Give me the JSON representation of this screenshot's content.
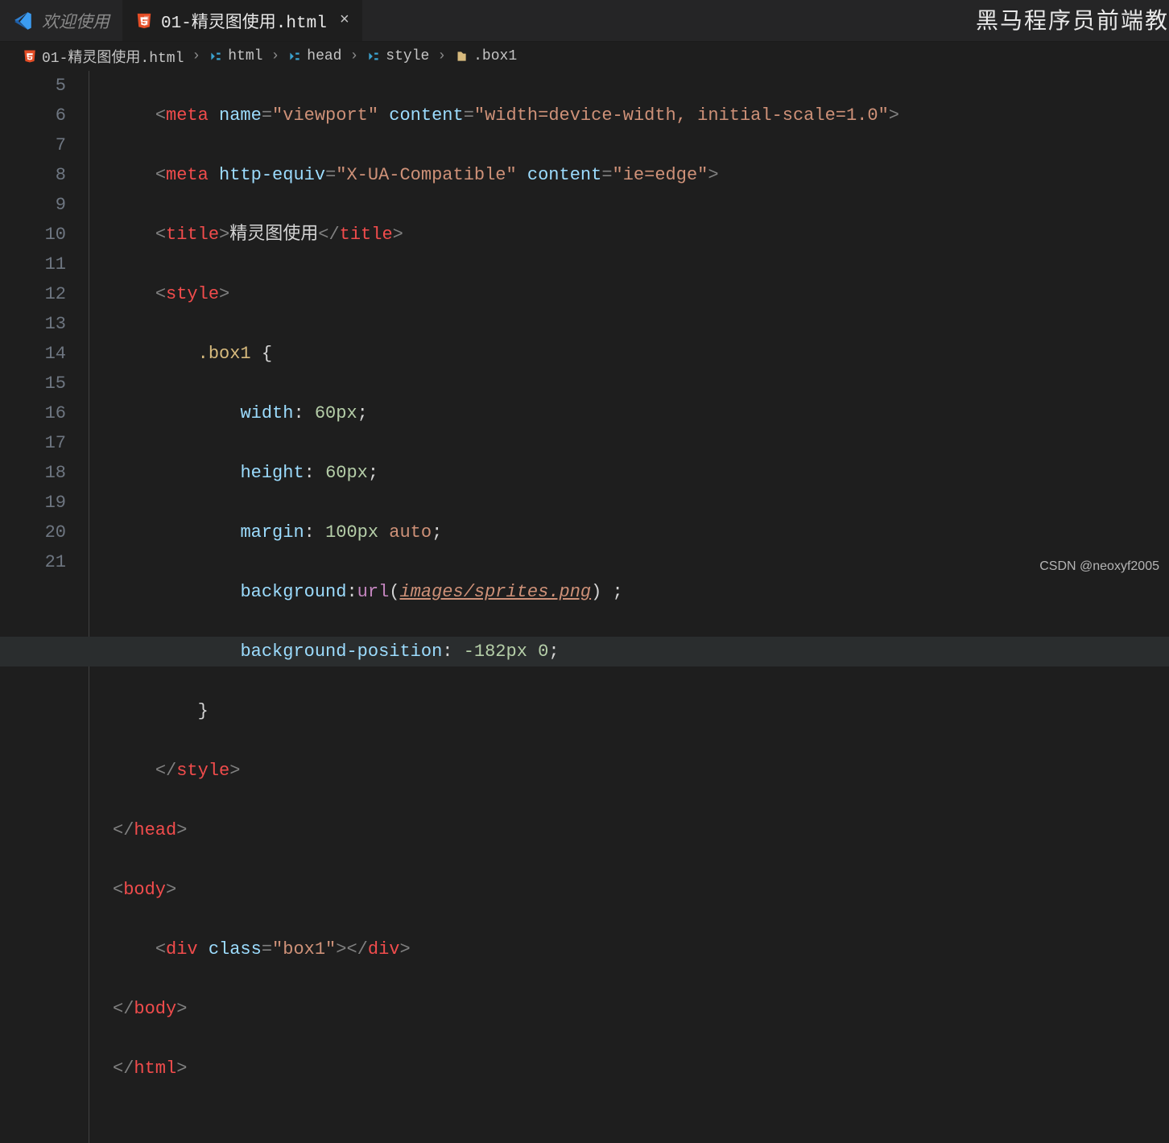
{
  "tabs": {
    "inactive": {
      "label": "欢迎使用"
    },
    "active": {
      "label": "01-精灵图使用.html",
      "close": "×"
    }
  },
  "watermark_top": "黑马程序员前端教",
  "watermark_bottom": "CSDN @neoxyf2005",
  "breadcrumbs": {
    "file": "01-精灵图使用.html",
    "path1": "html",
    "path2": "head",
    "path3": "style",
    "path4": ".box1",
    "sep": "›"
  },
  "lines": {
    "n5": "5",
    "n6": "6",
    "n7": "7",
    "n8": "8",
    "n9": "9",
    "n10": "10",
    "n11": "11",
    "n12": "12",
    "n13": "13",
    "n14": "14",
    "n15": "15",
    "n16": "16",
    "n17": "17",
    "n18": "18",
    "n19": "19",
    "n20": "20",
    "n21": "21"
  },
  "tok": {
    "lt": "<",
    "gt": ">",
    "lts": "</",
    "eq": "=",
    "ob": "{",
    "cb": "}",
    "sc": ";",
    "col": ":",
    "meta": "meta",
    "title": "title",
    "style": "style",
    "head": "head",
    "body": "body",
    "html": "html",
    "div": "div",
    "name": "name",
    "content": "content",
    "httpequiv": "http-equiv",
    "cls": "class",
    "q_viewport": "\"viewport\"",
    "q_vpcontent": "\"width=device-width, initial-scale=1.0\"",
    "q_xua": "\"X-UA-Compatible\"",
    "q_ie": "\"ie=edge\"",
    "q_box1": "\"box1\"",
    "title_text": "精灵图使用",
    "sel_box1": ".box1 ",
    "p_width": "width",
    "p_height": "height",
    "p_margin": "margin",
    "p_bg": "background",
    "p_bgpos": "background-position",
    "v_60px": "60px",
    "v_100px": "100px",
    "v_auto": "auto",
    "v_url": "url",
    "v_lp": "(",
    "v_rp": ")",
    "v_imgpath": "images/sprites.png",
    "v_neg182": "-182px",
    "v_zero": "0"
  }
}
